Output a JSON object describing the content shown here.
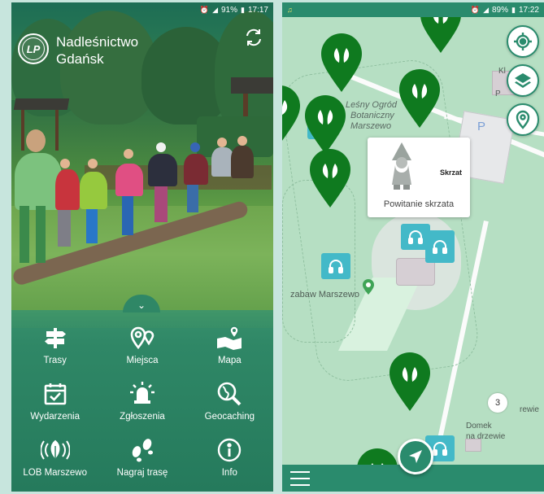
{
  "left_screen": {
    "status_bar": {
      "battery": "91%",
      "time": "17:17"
    },
    "header": {
      "title_line1": "Nadleśnictwo",
      "title_line2": "Gdańsk"
    },
    "menu": [
      {
        "label": "Trasy",
        "icon": "signpost-icon"
      },
      {
        "label": "Miejsca",
        "icon": "places-pin-icon"
      },
      {
        "label": "Mapa",
        "icon": "map-icon"
      },
      {
        "label": "Wydarzenia",
        "icon": "calendar-check-icon"
      },
      {
        "label": "Zgłoszenia",
        "icon": "alarm-bell-icon"
      },
      {
        "label": "Geocaching",
        "icon": "globe-search-icon"
      },
      {
        "label": "LOB Marszewo",
        "icon": "broadcast-leaf-icon"
      },
      {
        "label": "Nagraj trasę",
        "icon": "footprints-icon"
      },
      {
        "label": "Info",
        "icon": "info-icon"
      }
    ]
  },
  "right_screen": {
    "status_bar": {
      "battery": "89%",
      "time": "17:22"
    },
    "map_labels": {
      "garden_line1": "Leśny Ogród",
      "garden_line2": "Botaniczny",
      "garden_line3": "Marszewo",
      "playground": "zabaw Marszewo",
      "cottage_line1": "Domek",
      "cottage_line2": "na drzewie",
      "cottage2_partial": "rewie",
      "top_partial_1": "Kl",
      "top_partial_2": "P",
      "parking": "P"
    },
    "popup": {
      "name": "Skrzat",
      "description": "Powitanie skrzata"
    },
    "cluster_count": "3",
    "colors": {
      "pin": "#0f7a1f",
      "audio": "#43b9c8",
      "accent": "#2a8b6d"
    }
  }
}
